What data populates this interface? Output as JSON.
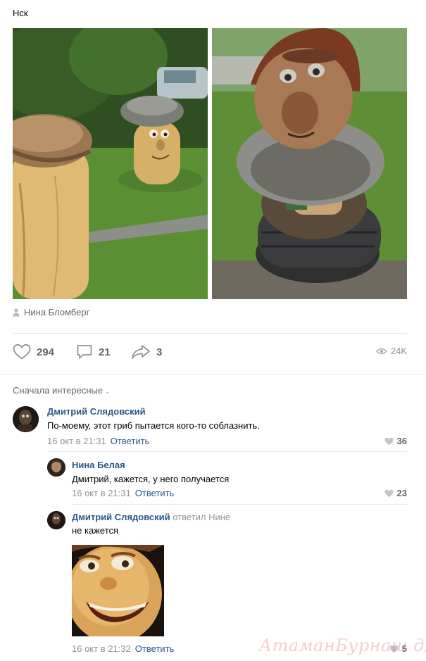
{
  "post": {
    "text": "Нск",
    "author": "Нина Бломберг"
  },
  "actions": {
    "likes": "294",
    "comments": "21",
    "shares": "3",
    "views": "24K"
  },
  "comments_section": {
    "sort_label": "Сначала интересные",
    "items": [
      {
        "name": "Дмитрий Слядовский",
        "text": "По-моему, этот гриб пытается кого-то соблазнить.",
        "date": "16 окт в 21:31",
        "reply_label": "Ответить",
        "likes": "36"
      },
      {
        "name": "Нина Белая",
        "text": "Дмитрий, кажется, у него получается",
        "date": "16 окт в 21:31",
        "reply_label": "Ответить",
        "likes": "23"
      },
      {
        "name": "Дмитрий Слядовский",
        "reply_to": "ответил Нине",
        "text": "не кажется",
        "date": "16 окт в 21:32",
        "reply_label": "Ответить",
        "likes": "5"
      }
    ]
  },
  "watermark": "АтаманБурнаш для ЯП",
  "colors": {
    "link": "#2a5885",
    "muted": "#939393",
    "divider": "#e7e8ec"
  }
}
